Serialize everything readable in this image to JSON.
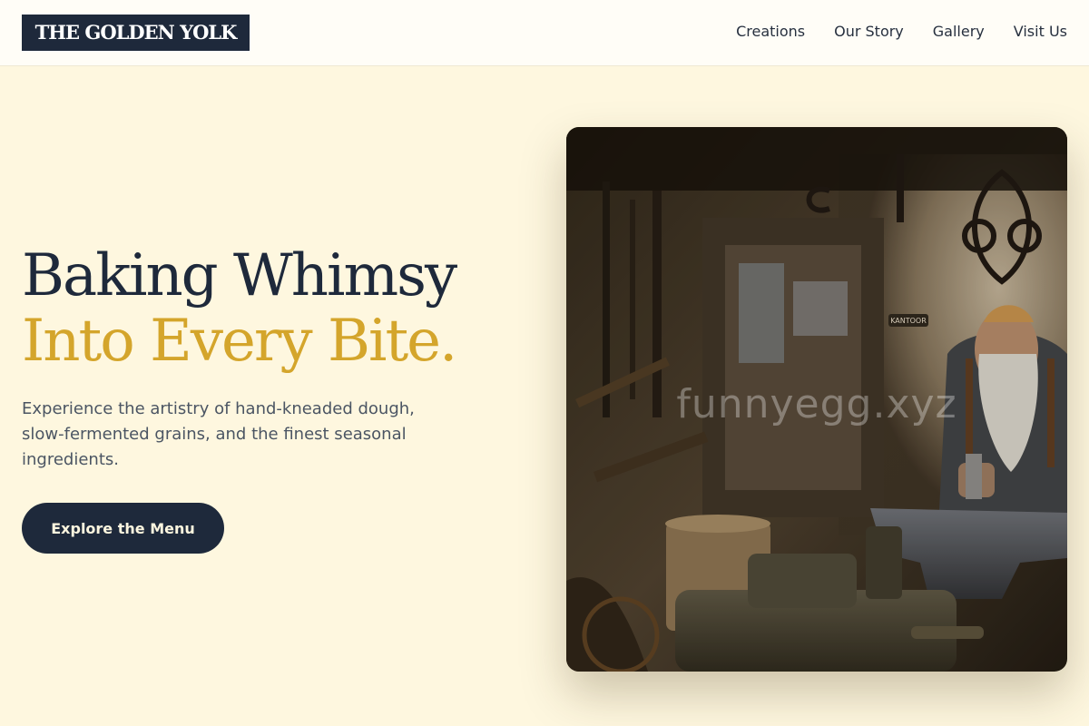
{
  "brand": {
    "name": "THE GOLDEN YOLK"
  },
  "nav": {
    "items": [
      {
        "label": "Creations"
      },
      {
        "label": "Our Story"
      },
      {
        "label": "Gallery"
      },
      {
        "label": "Visit Us"
      }
    ]
  },
  "hero": {
    "headline_line1": "Baking Whimsy",
    "headline_line2": "Into Every Bite.",
    "description": "Experience the artistry of hand-kneaded dough, slow-fermented grains, and the finest seasonal ingredients.",
    "cta_label": "Explore the Menu",
    "image": {
      "alt": "Bearded blacksmith hammering at an anvil in a cluttered workshop",
      "watermark": "funnyegg.xyz",
      "sign_text": "KANTOOR"
    }
  },
  "colors": {
    "page_background": "#fef7df",
    "header_background": "#fffdf7",
    "brand_navy": "#1e293b",
    "accent_gold": "#d4a52b",
    "body_text": "#4b5563"
  }
}
